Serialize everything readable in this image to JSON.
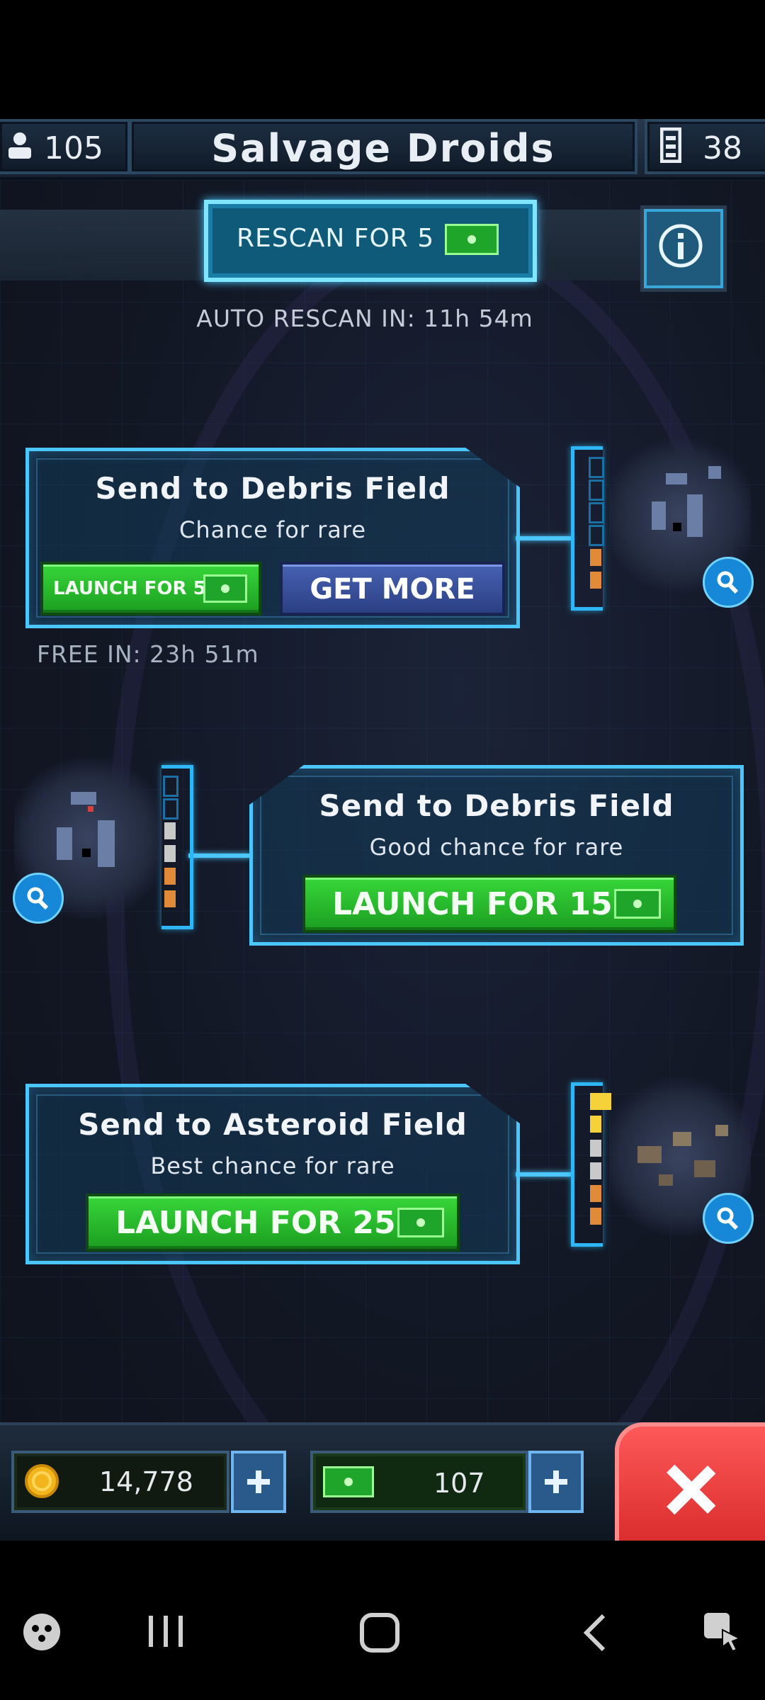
{
  "header": {
    "crew_count": "105",
    "title": "Salvage Droids",
    "droid_count": "38"
  },
  "scan": {
    "rescan_label": "RESCAN FOR 5",
    "auto_rescan": "AUTO RESCAN IN: 11h 54m"
  },
  "missions": [
    {
      "title": "Send to Debris Field",
      "subtitle": "Chance for rare",
      "launch_label": "LAUNCH FOR 5",
      "get_more_label": "GET MORE",
      "free_in": "FREE IN: 23h 51m",
      "rarity_level": 2
    },
    {
      "title": "Send to Debris Field",
      "subtitle": "Good chance for rare",
      "launch_label": "LAUNCH FOR 15",
      "rarity_level": 4
    },
    {
      "title": "Send to Asteroid Field",
      "subtitle": "Best chance for rare",
      "launch_label": "LAUNCH FOR 25",
      "rarity_level": 6
    }
  ],
  "resources": {
    "coins": "14,778",
    "gems": "107"
  },
  "colors": {
    "panel_border": "#4cc6ff",
    "launch_button": "#27c02c",
    "get_more_button": "#3a52a0",
    "close_button": "#e53935"
  },
  "icons": [
    "crew-icon",
    "droid-icon",
    "info-icon",
    "gem-icon",
    "magnify-icon",
    "coin-icon",
    "plus-icon",
    "close-icon"
  ],
  "system_nav": [
    "game-launcher-icon",
    "recent-apps-icon",
    "home-icon",
    "back-icon",
    "screen-tool-icon"
  ]
}
